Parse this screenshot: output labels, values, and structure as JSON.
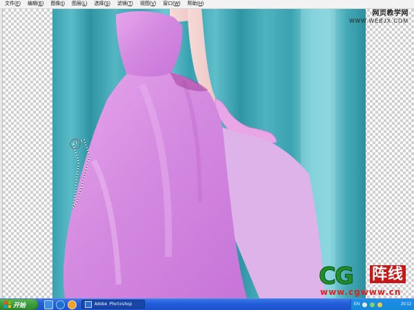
{
  "menu": {
    "items": [
      {
        "label": "文件",
        "key": "F"
      },
      {
        "label": "编辑",
        "key": "E"
      },
      {
        "label": "图像",
        "key": "I"
      },
      {
        "label": "图层",
        "key": "L"
      },
      {
        "label": "选择",
        "key": "S"
      },
      {
        "label": "滤镜",
        "key": "T"
      },
      {
        "label": "视图",
        "key": "V"
      },
      {
        "label": "窗口",
        "key": "W"
      },
      {
        "label": "帮助",
        "key": "H"
      }
    ]
  },
  "watermark_top": {
    "title": "网页教学网",
    "url": "WWW.WEBJX.COM"
  },
  "watermark_cg": {
    "letters": "CG",
    "han": "阵线",
    "url": "www.cgwww.cn"
  },
  "taskbar": {
    "start_label": "开始",
    "task_label": "Adobe Photoshop",
    "lang": "EN",
    "clock": "20:12"
  },
  "colors": {
    "backdrop": "#3aa1b0",
    "dress": "#d58be0",
    "selection_fill": "#deb3ea"
  }
}
